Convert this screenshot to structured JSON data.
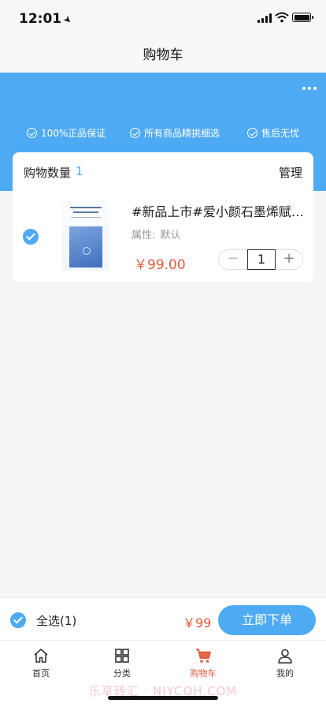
{
  "status_bar": {
    "time": "12:01",
    "location_glyph": "➤"
  },
  "nav": {
    "title": "购物车"
  },
  "guarantees": [
    "100%正品保证",
    "所有商品精挑细选",
    "售后无忧"
  ],
  "cart": {
    "count_label": "购物数量",
    "count_value": "1",
    "manage_label": "管理",
    "items": [
      {
        "title": "#新品上市#爱小颜石墨烯赋润…",
        "attr_label": "属性:",
        "attr_value": "默认",
        "price": "￥99.00",
        "quantity": "1",
        "checked": true
      }
    ]
  },
  "stepper": {
    "minus": "−",
    "plus": "+"
  },
  "checkout": {
    "select_all_label": "全选(1)",
    "total": "￥99",
    "buy_label": "立即下单"
  },
  "tabs": [
    {
      "label": "首页",
      "icon": "home-icon",
      "active": false
    },
    {
      "label": "分类",
      "icon": "grid-icon",
      "active": false
    },
    {
      "label": "购物车",
      "icon": "cart-icon",
      "active": true
    },
    {
      "label": "我的",
      "icon": "user-icon",
      "active": false
    }
  ],
  "watermark": "乐享转汇 · NIYCOH.COM",
  "colors": {
    "accent": "#4faaf4",
    "price": "#e05a3a",
    "background": "#f5f5f5"
  }
}
